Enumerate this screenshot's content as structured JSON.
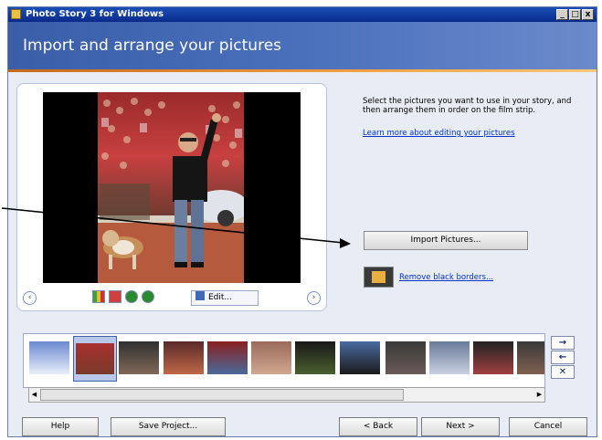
{
  "window": {
    "title": "Photo Story 3 for Windows",
    "minimize": "_",
    "maximize": "□",
    "close": "x"
  },
  "header": {
    "page_title": "Import and arrange your pictures"
  },
  "main": {
    "instructions": "Select the pictures you want to use in your story, and then arrange them in order on the film strip.",
    "learn_link": "Learn more about editing your pictures",
    "import_button": "Import Pictures...",
    "remove_borders_link": "Remove black borders..."
  },
  "preview": {
    "prev_icon": "‹",
    "next_icon": "›",
    "edit_button": "Edit..."
  },
  "filmstrip": {
    "selected_index": 1,
    "thumbnail_count": 12,
    "move_right": "→",
    "move_left": "←",
    "delete": "✕"
  },
  "footer": {
    "help": "Help",
    "save_project": "Save Project...",
    "back": "< Back",
    "next": "Next >",
    "cancel": "Cancel"
  },
  "colors": {
    "header_blue": "#4a70bc",
    "accent_orange": "#f2a040",
    "link_blue": "#0033cc"
  }
}
